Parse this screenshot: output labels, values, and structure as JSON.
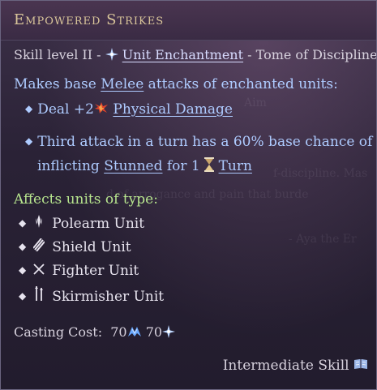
{
  "tooltip": {
    "title": "Empowered Strikes",
    "subtitle": {
      "prefix": "Skill level II -",
      "link": "Unit Enchantment",
      "suffix": "- Tome of Discipline"
    },
    "description": {
      "pre": "Makes base ",
      "link": "Melee",
      "post": " attacks of enchanted units:"
    },
    "effects": [
      {
        "pre": "Deal +2",
        "link": "Physical Damage",
        "icon": "physical-damage-icon"
      },
      {
        "line1": "Third attack in a turn has a 60% base chance of",
        "line2_pre": "inflicting ",
        "link": "Stunned",
        "line2_mid": " for 1",
        "turn_link": "Turn",
        "icon": "hourglass-icon"
      }
    ],
    "affects_label": "Affects units of type:",
    "unit_types": [
      {
        "label": "Polearm Unit",
        "icon": "polearm-icon"
      },
      {
        "label": "Shield Unit",
        "icon": "shield-icon"
      },
      {
        "label": "Fighter Unit",
        "icon": "fighter-icon"
      },
      {
        "label": "Skirmisher Unit",
        "icon": "skirmisher-icon"
      }
    ],
    "casting_cost": {
      "label": "Casting Cost:",
      "mana_value": "70",
      "mana_icon": "mana-icon",
      "imperium_value": "70",
      "imperium_icon": "arcana-icon"
    },
    "footer": {
      "label": "Intermediate Skill",
      "icon": "book-icon"
    }
  },
  "background_text": {
    "line_a": "Aim",
    "line_b": "f-discipline. Mas",
    "line_c": "d of arrogance and pain that burde",
    "line_d": "- Aya the Er"
  }
}
